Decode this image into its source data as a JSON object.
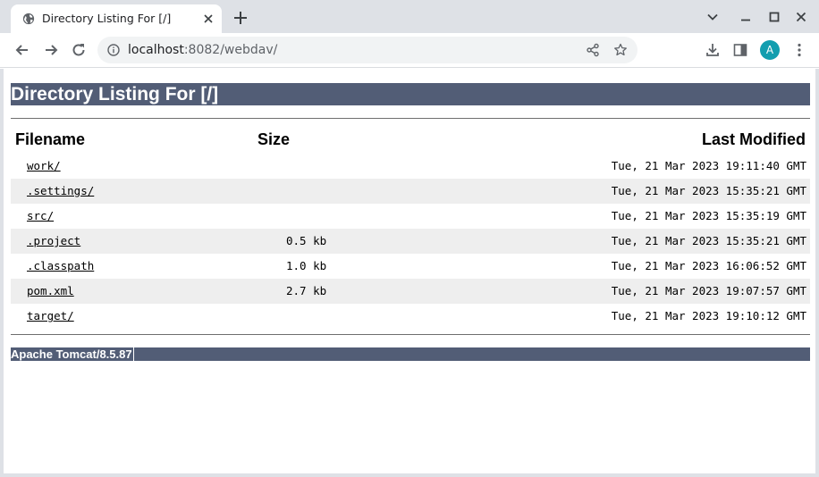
{
  "browser": {
    "tab_title": "Directory Listing For [/]",
    "url_host": "localhost",
    "url_rest": ":8082/webdav/",
    "avatar_letter": "A",
    "accent_color": "#129eaf"
  },
  "icons": {
    "favicon": "globe-icon",
    "tab_close": "close-icon",
    "new_tab": "plus-icon",
    "back": "arrow-left-icon",
    "forward": "arrow-right-icon",
    "reload": "reload-icon",
    "site_info": "info-icon",
    "share": "share-icon",
    "bookmark": "star-icon",
    "download": "download-icon",
    "side_panel": "side-panel-icon",
    "menu": "kebab-menu-icon",
    "minimize": "minimize-icon",
    "maximize": "maximize-icon",
    "close_window": "close-icon",
    "tab_search": "chevron-down-icon"
  },
  "page": {
    "title": "Directory Listing For [/]",
    "title_bg": "#525d76",
    "columns": {
      "filename": "Filename",
      "size": "Size",
      "modified": "Last Modified"
    },
    "rows": [
      {
        "name": "work/",
        "size": "",
        "modified": "Tue, 21 Mar 2023 19:11:40 GMT"
      },
      {
        "name": ".settings/",
        "size": "",
        "modified": "Tue, 21 Mar 2023 15:35:21 GMT"
      },
      {
        "name": "src/",
        "size": "",
        "modified": "Tue, 21 Mar 2023 15:35:19 GMT"
      },
      {
        "name": ".project",
        "size": "0.5 kb",
        "modified": "Tue, 21 Mar 2023 15:35:21 GMT"
      },
      {
        "name": ".classpath",
        "size": "1.0 kb",
        "modified": "Tue, 21 Mar 2023 16:06:52 GMT"
      },
      {
        "name": "pom.xml",
        "size": "2.7 kb",
        "modified": "Tue, 21 Mar 2023 19:07:57 GMT"
      },
      {
        "name": "target/",
        "size": "",
        "modified": "Tue, 21 Mar 2023 19:10:12 GMT"
      }
    ],
    "footer": "Apache Tomcat/8.5.87"
  }
}
